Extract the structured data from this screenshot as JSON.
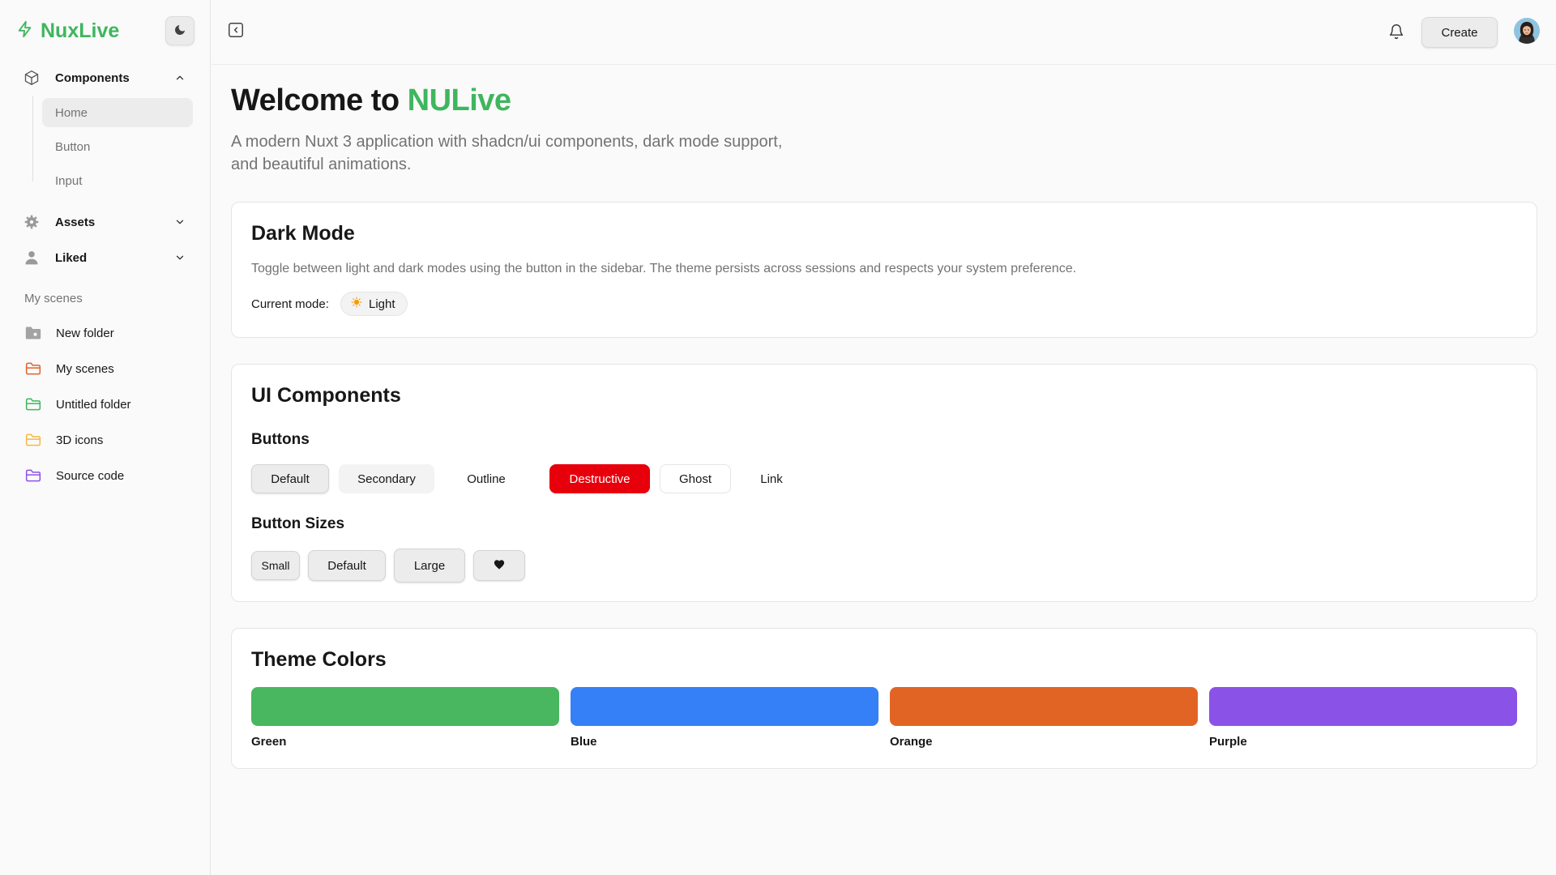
{
  "app": {
    "name": "NuxLive"
  },
  "sidebar": {
    "groups": [
      {
        "label": "Components",
        "icon": "cube-icon",
        "expanded": true,
        "items": [
          "Home",
          "Button",
          "Input"
        ],
        "active": "Home"
      },
      {
        "label": "Assets",
        "icon": "gear-icon",
        "expanded": false
      },
      {
        "label": "Liked",
        "icon": "user-icon",
        "expanded": false
      }
    ],
    "section_label": "My scenes",
    "folders": [
      {
        "label": "New folder",
        "color": "#a3a3a3"
      },
      {
        "label": "My scenes",
        "color": "#e2622a"
      },
      {
        "label": "Untitled folder",
        "color": "#3fb65e"
      },
      {
        "label": "3D icons",
        "color": "#f5b942"
      },
      {
        "label": "Source code",
        "color": "#8b52e8"
      }
    ]
  },
  "header": {
    "create_label": "Create"
  },
  "hero": {
    "title_prefix": "Welcome to ",
    "title_accent": "NULive",
    "subtitle": "A modern Nuxt 3 application with shadcn/ui components, dark mode support, and beautiful animations."
  },
  "dark_mode_card": {
    "title": "Dark Mode",
    "description": "Toggle between light and dark modes using the button in the sidebar. The theme persists across sessions and respects your system preference.",
    "current_label": "Current mode:",
    "current_value": "Light"
  },
  "ui_components_card": {
    "title": "UI Components",
    "buttons_heading": "Buttons",
    "buttons": {
      "default": "Default",
      "secondary": "Secondary",
      "outline": "Outline",
      "destructive": "Destructive",
      "ghost": "Ghost",
      "link": "Link"
    },
    "sizes_heading": "Button Sizes",
    "sizes": {
      "small": "Small",
      "default": "Default",
      "large": "Large"
    }
  },
  "theme_colors_card": {
    "title": "Theme Colors",
    "colors": [
      {
        "name": "Green",
        "hex": "#48b75f"
      },
      {
        "name": "Blue",
        "hex": "#3580f7"
      },
      {
        "name": "Orange",
        "hex": "#e26424"
      },
      {
        "name": "Purple",
        "hex": "#8b52e8"
      }
    ]
  }
}
